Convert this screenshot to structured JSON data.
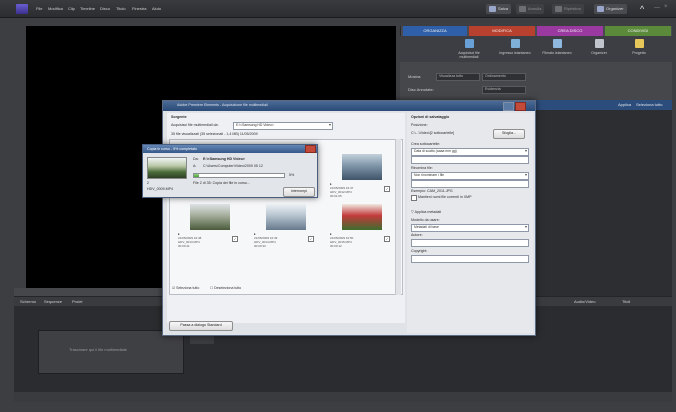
{
  "menubar": {
    "items": [
      "File",
      "Modifica",
      "Clip",
      "Timeline",
      "Disco",
      "Titolo",
      "Finestra",
      "Aiuto"
    ],
    "right_buttons": [
      "Salva",
      "Annulla",
      "Ripristina",
      "Organizer"
    ]
  },
  "right_panel": {
    "tabs": [
      {
        "label": "ORGANIZZA",
        "color": "#2f5fa8"
      },
      {
        "label": "MODIFICA",
        "color": "#b8402e"
      },
      {
        "label": "CREA DISCO",
        "color": "#9a3aa0"
      },
      {
        "label": "CONDIVIDI",
        "color": "#5a8a3a"
      }
    ],
    "tools": [
      {
        "label": "Acquisisci file multimediali",
        "icon": "import-icon",
        "color": "#6aa0d8"
      },
      {
        "label": "Ingresso istantaneo",
        "icon": "snap-icon",
        "color": "#7fb0d8"
      },
      {
        "label": "Filmato istantaneo",
        "icon": "film-icon",
        "color": "#8eb8e0"
      },
      {
        "label": "Organizer",
        "icon": "organizer-icon",
        "color": "#c0c4cc"
      },
      {
        "label": "Progetto",
        "icon": "folder-icon",
        "color": "#e7c75a"
      }
    ],
    "row1_label": "Mostra:",
    "row1_values": [
      "Visualizza tutto",
      "Ordinamento"
    ],
    "row2_label": "Disc Annotate:",
    "row2_value": "Evidenzia",
    "media_label": "Applica",
    "media_label2": "Seleziona tutto"
  },
  "timeline": {
    "tabs": [
      "Schermo",
      "Sequenze",
      "Proiet"
    ],
    "clip_text": "Trascinare qui il file multimediale",
    "right_tabs": [
      "Audio/Video",
      "Titoli"
    ]
  },
  "dialog": {
    "title": "Adobe Premiere Elements - Acquisizione file multimediali",
    "source_label": "Sorgente",
    "source_from": "Acquisisci file multimediali da:",
    "source_value": "E:\\<Samsung HD Video>",
    "selected_info": "35 file visualizzati (35 selezionati - 1,4 MB) 11/05/2009",
    "thumbs": [
      {
        "lines": [
          "21/05/2009 16:45",
          "HDV_0010.MP4",
          "00:00:16"
        ],
        "colors": [
          "#e9ecef",
          "#cdd3d9",
          "#6c7b86"
        ],
        "checked": true
      },
      {
        "lines": [
          "21/05/2009 16:46",
          "HDV_0011.MP4",
          "00:00:22"
        ],
        "colors": [
          "#5f7f49",
          "#9aa88a",
          "#d6e0e6"
        ],
        "checked": true
      },
      {
        "lines": [
          "21/05/2009 16:47",
          "HDV_0012.MP4",
          "00:01:05"
        ],
        "colors": [
          "#3f5468",
          "#7f95a8",
          "#c3d1dc"
        ],
        "checked": true
      },
      {
        "lines": [
          "21/05/2009 16:48",
          "HDV_0013.MP4",
          "00:00:41"
        ],
        "colors": [
          "#4a5a3a",
          "#a3ad9a",
          "#dfe3e6"
        ],
        "checked": true
      },
      {
        "lines": [
          "21/05/2009 16:49",
          "HDV_0014.MP4",
          "00:00:33"
        ],
        "colors": [
          "#667a8d",
          "#b6c3cf",
          "#eef2f5"
        ],
        "checked": true
      },
      {
        "lines": [
          "21/05/2009 16:50",
          "HDV_0015.MP4",
          "00:00:12"
        ],
        "colors": [
          "#3c6e2e",
          "#c23a3a",
          "#f0e8e0"
        ],
        "checked": true
      }
    ],
    "select_all": "Seleziona tutto",
    "deselect_all": "Deseleziona tutto",
    "advanced_button": "Passa a dialogo Standard",
    "get_button": "Acquisisci file multimediali",
    "cancel_button": "Annulla",
    "right": {
      "save_options": "Opzioni di salvataggio",
      "location_label": "Posizione:",
      "location_value": "C:\\...\\Video\\[2 sottocartelle]",
      "browse_button": "Sfoglia...",
      "subfolder_label": "Crea sottocartelle:",
      "subfolder_value": "Data di scatto (aaaa mm gg)",
      "rename_label": "Rinomina file:",
      "rename_value": "Non rinominare i file",
      "sample_label": "Esempio: CAM_2011.JPG",
      "keep_name_label": "Mantieni nomi file correnti in XMP",
      "metadata_label": "Applica metadati",
      "template_label": "Modello da usare:",
      "template_value": "Metadati di base",
      "author_label": "Autore:",
      "copyright_label": "Copyright:"
    }
  },
  "progress": {
    "title": "Copia in corso - 5% completato",
    "from_label": "Da:",
    "from_value": "E:\\<Samsung HD Video>",
    "to_label": "A:",
    "to_value": "C:\\Users\\Computer\\Video\\2009 05 12",
    "percent_text": "5%",
    "percent_value": 5,
    "status": "File 2 di 35: Copia dei file in corso...",
    "file_name": "HDV_0009.MP4",
    "file_index": "2",
    "stop_button": "Interrompi"
  }
}
